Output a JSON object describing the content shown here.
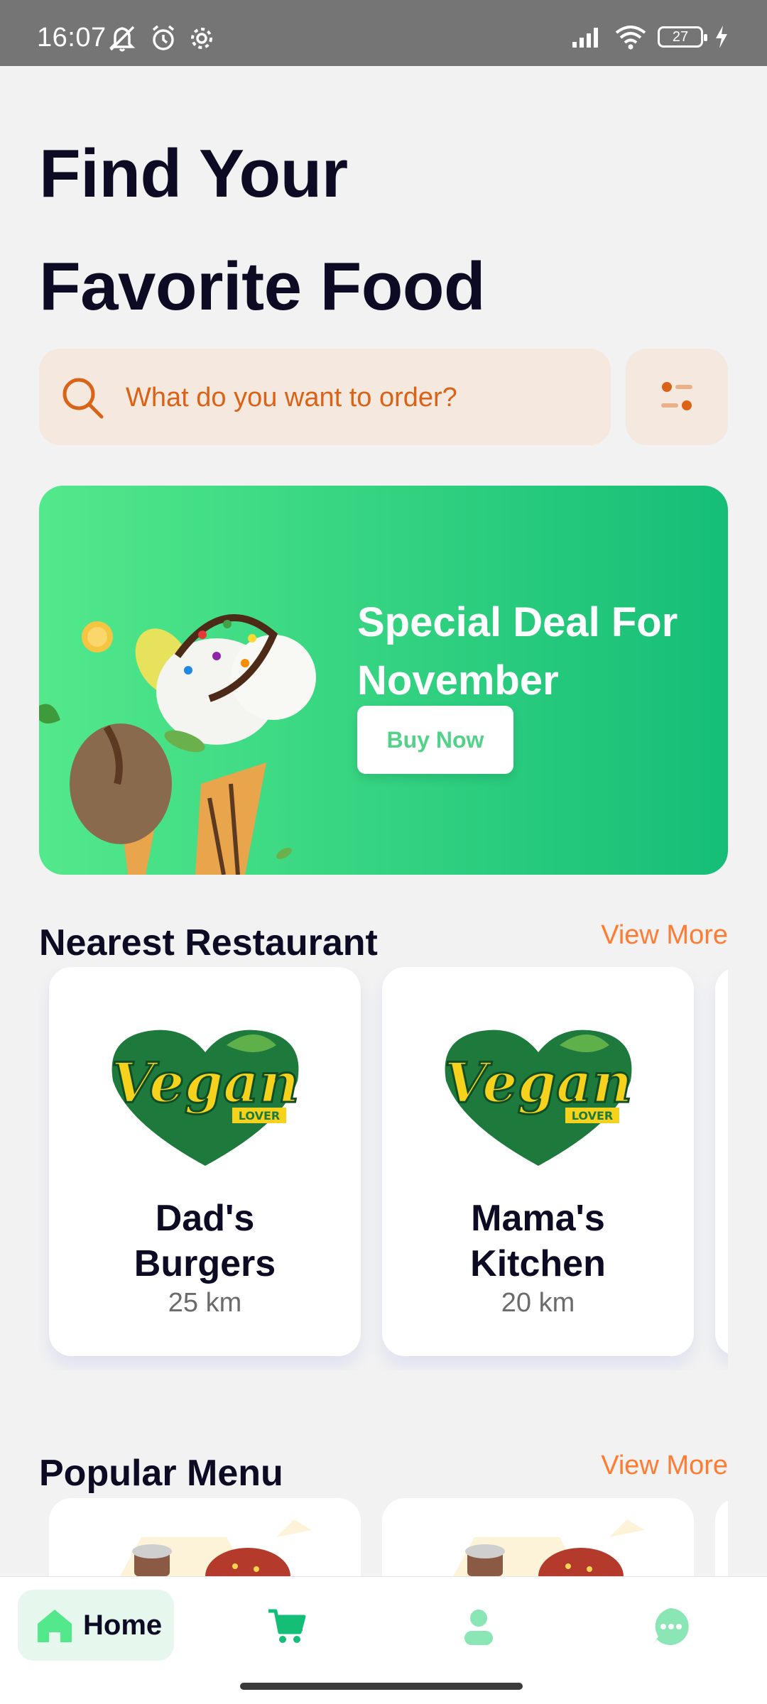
{
  "status_bar": {
    "time": "16:07",
    "battery": "27",
    "left_icons": [
      "mute-icon",
      "alarm-icon",
      "settings-icon"
    ],
    "right_icons": [
      "signal-icon",
      "wifi-icon",
      "battery-icon",
      "charging-icon"
    ]
  },
  "header": {
    "title_line1": "Find Your",
    "title_line2": "Favorite Food"
  },
  "search": {
    "placeholder": "What do you want to order?",
    "icon": "search-icon",
    "filter_icon": "filter-icon"
  },
  "promo": {
    "title": "Special Deal For November",
    "button_label": "Buy Now"
  },
  "nearest_restaurant": {
    "title": "Nearest Restaurant",
    "view_more": "View More",
    "items": [
      {
        "name": "Dad's Burgers",
        "distance": "25 km",
        "logo_text": "Vegan",
        "logo_subtext": "LOVER"
      },
      {
        "name": "Mama's Kitchen",
        "distance": "20 km",
        "logo_text": "Vegan",
        "logo_subtext": "LOVER"
      }
    ]
  },
  "popular_menu": {
    "title": "Popular Menu",
    "view_more": "View More"
  },
  "bottom_nav": {
    "items": [
      {
        "label": "Home",
        "icon": "home-icon",
        "active": true
      },
      {
        "label": "",
        "icon": "cart-icon",
        "active": false
      },
      {
        "label": "",
        "icon": "profile-icon",
        "active": false
      },
      {
        "label": "",
        "icon": "chat-icon",
        "active": false
      }
    ]
  },
  "colors": {
    "accent_green": "#15BE77",
    "accent_orange": "#FF7C32",
    "search_bg": "#F4E8DF",
    "title_text": "#0D0B24"
  }
}
